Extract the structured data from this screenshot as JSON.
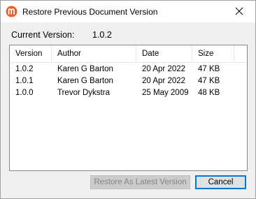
{
  "window": {
    "title": "Restore Previous Document Version",
    "icon": "app-logo-icon",
    "close_icon": "close-icon"
  },
  "current_version": {
    "label": "Current Version:",
    "value": "1.0.2"
  },
  "versions_table": {
    "columns": [
      "Version",
      "Author",
      "Date",
      "Size"
    ],
    "rows": [
      [
        "1.0.2",
        "Karen G Barton",
        "20 Apr 2022",
        "47 KB"
      ],
      [
        "1.0.1",
        "Karen G Barton",
        "20 Apr 2022",
        "47 KB"
      ],
      [
        "1.0.0",
        "Trevor Dykstra",
        "25 May 2009",
        "48 KB"
      ]
    ]
  },
  "buttons": {
    "restore_label": "Restore As Latest Version",
    "cancel_label": "Cancel"
  },
  "colors": {
    "brand": "#f15a24",
    "focus_border": "#0078d7",
    "disabled_text": "#838383"
  }
}
